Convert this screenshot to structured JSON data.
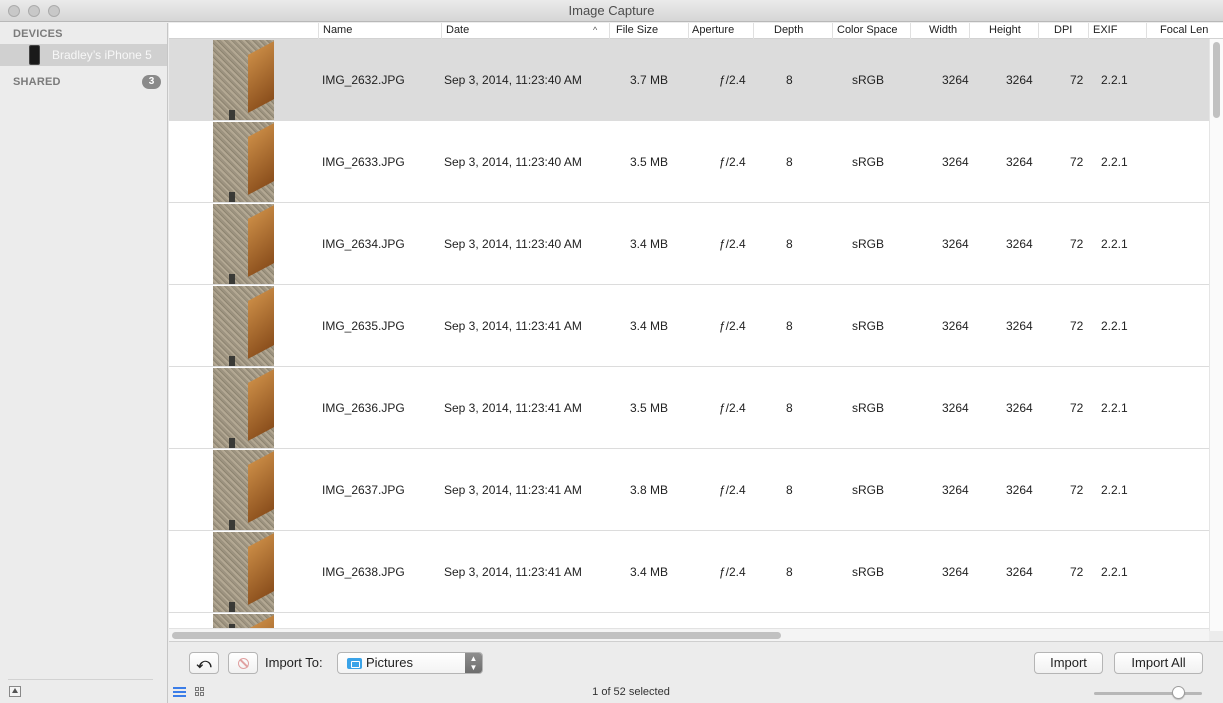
{
  "window": {
    "title": "Image Capture"
  },
  "sidebar": {
    "devices_header": "DEVICES",
    "device_name": "Bradley’s iPhone 5",
    "shared_header": "SHARED",
    "shared_count": "3"
  },
  "table": {
    "columns": [
      "Name",
      "Date",
      "File Size",
      "Aperture",
      "Depth",
      "Color Space",
      "Width",
      "Height",
      "DPI",
      "EXIF",
      "Focal Len"
    ],
    "sort_column": "Date",
    "rows": [
      {
        "name": "IMG_2632.JPG",
        "date": "Sep 3, 2014, 11:23:40 AM",
        "size": "3.7 MB",
        "aperture": "ƒ/2.4",
        "depth": "8",
        "colorspace": "sRGB",
        "width": "3264",
        "height": "3264",
        "dpi": "72",
        "exif": "2.2.1",
        "selected": true
      },
      {
        "name": "IMG_2633.JPG",
        "date": "Sep 3, 2014, 11:23:40 AM",
        "size": "3.5 MB",
        "aperture": "ƒ/2.4",
        "depth": "8",
        "colorspace": "sRGB",
        "width": "3264",
        "height": "3264",
        "dpi": "72",
        "exif": "2.2.1",
        "selected": false
      },
      {
        "name": "IMG_2634.JPG",
        "date": "Sep 3, 2014, 11:23:40 AM",
        "size": "3.4 MB",
        "aperture": "ƒ/2.4",
        "depth": "8",
        "colorspace": "sRGB",
        "width": "3264",
        "height": "3264",
        "dpi": "72",
        "exif": "2.2.1",
        "selected": false
      },
      {
        "name": "IMG_2635.JPG",
        "date": "Sep 3, 2014, 11:23:41 AM",
        "size": "3.4 MB",
        "aperture": "ƒ/2.4",
        "depth": "8",
        "colorspace": "sRGB",
        "width": "3264",
        "height": "3264",
        "dpi": "72",
        "exif": "2.2.1",
        "selected": false
      },
      {
        "name": "IMG_2636.JPG",
        "date": "Sep 3, 2014, 11:23:41 AM",
        "size": "3.5 MB",
        "aperture": "ƒ/2.4",
        "depth": "8",
        "colorspace": "sRGB",
        "width": "3264",
        "height": "3264",
        "dpi": "72",
        "exif": "2.2.1",
        "selected": false
      },
      {
        "name": "IMG_2637.JPG",
        "date": "Sep 3, 2014, 11:23:41 AM",
        "size": "3.8 MB",
        "aperture": "ƒ/2.4",
        "depth": "8",
        "colorspace": "sRGB",
        "width": "3264",
        "height": "3264",
        "dpi": "72",
        "exif": "2.2.1",
        "selected": false
      },
      {
        "name": "IMG_2638.JPG",
        "date": "Sep 3, 2014, 11:23:41 AM",
        "size": "3.4 MB",
        "aperture": "ƒ/2.4",
        "depth": "8",
        "colorspace": "sRGB",
        "width": "3264",
        "height": "3264",
        "dpi": "72",
        "exif": "2.2.1",
        "selected": false
      }
    ]
  },
  "toolbar": {
    "import_to_label": "Import To:",
    "destination": "Pictures",
    "import_label": "Import",
    "import_all_label": "Import All",
    "status_text": "1 of 52 selected"
  },
  "colors": {
    "selection": "#dcdcdc",
    "folder_accent": "#3aa3e8",
    "list_view_active": "#3b7de8"
  }
}
